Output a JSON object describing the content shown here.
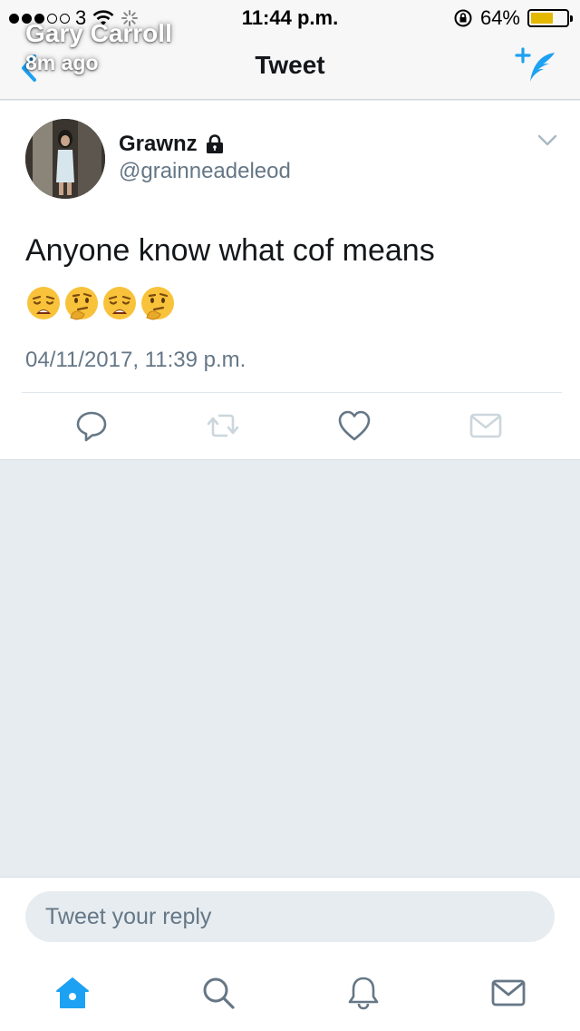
{
  "status_bar": {
    "carrier": "3",
    "time": "11:44 p.m.",
    "battery": "64%",
    "battery_level": 0.64
  },
  "overlay": {
    "name": "Gary Carroll",
    "time_ago": "8m ago"
  },
  "nav": {
    "title": "Tweet",
    "back_icon": "chevron-left-icon",
    "compose_icon": "compose-tweet-icon"
  },
  "tweet": {
    "display_name": "Grawnz",
    "protected_icon": "lock-icon",
    "handle": "@grainneadeleod",
    "text": "Anyone know what cof means",
    "emojis": [
      "weary-face",
      "thinking-face",
      "weary-face",
      "thinking-face"
    ],
    "timestamp": "04/11/2017, 11:39 p.m.",
    "actions": [
      "reply-icon",
      "retweet-icon",
      "like-icon",
      "direct-message-icon"
    ]
  },
  "reply": {
    "placeholder": "Tweet your reply"
  },
  "tab_bar": {
    "tabs": [
      "home-icon",
      "search-icon",
      "notifications-icon",
      "messages-icon"
    ],
    "active": "home-icon"
  },
  "colors": {
    "accent": "#1da1f2",
    "secondary_text": "#657786",
    "background": "#e6ecf0"
  }
}
